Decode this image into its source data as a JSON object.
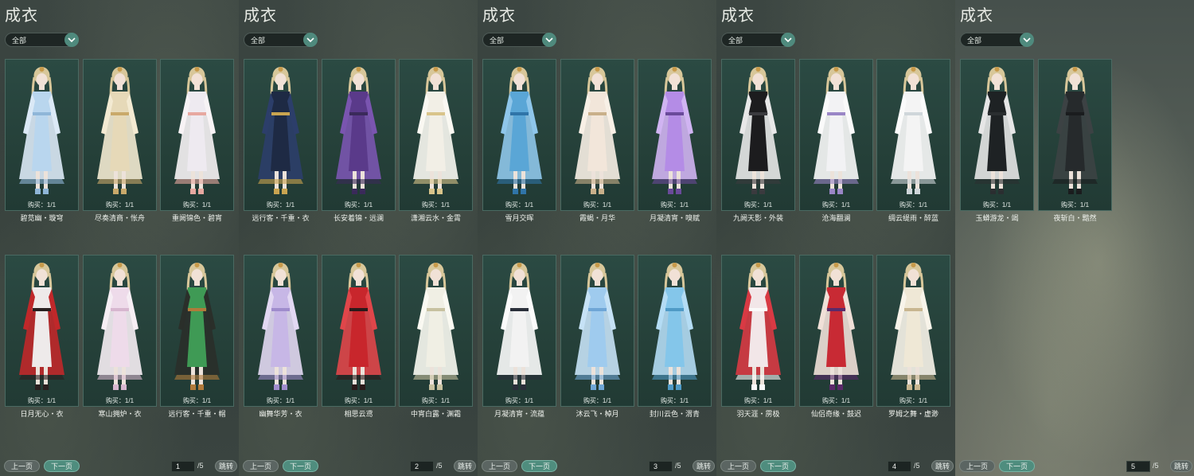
{
  "colors": {
    "accent": "#4f8d7e",
    "card_bg": "#254039",
    "text": "#eef1ec"
  },
  "icons": {
    "filter_dropdown": "chevron-down-icon",
    "outfit_figure": "character-figure-icon"
  },
  "panels": [
    {
      "title": "成衣",
      "filter": "全部",
      "prev_label": "上一页",
      "next_label": "下一页",
      "page": "1",
      "total": "/5",
      "jump_label": "跳转",
      "items": [
        {
          "name": "碧苋幽・璇穹",
          "buy": "购买：1/1",
          "palette": [
            "#b9d6ee",
            "#dbe9f6",
            "#8fb6d8"
          ]
        },
        {
          "name": "尽奏清商・怅舟",
          "buy": "购买：1/1",
          "palette": [
            "#e6d9b8",
            "#f3ead2",
            "#c9a96a"
          ]
        },
        {
          "name": "重阙锦色・碧宵",
          "buy": "购买：1/1",
          "palette": [
            "#eeeaf0",
            "#f7f3f5",
            "#e7a8a0"
          ]
        },
        {
          "name": "日月无心・衣",
          "buy": "购买：1/1",
          "palette": [
            "#eeeaea",
            "#c0282a",
            "#2a2020"
          ]
        },
        {
          "name": "寒山拥炉・衣",
          "buy": "购买：1/1",
          "palette": [
            "#eedbea",
            "#f6eef4",
            "#d7b7cf"
          ]
        },
        {
          "name": "远行客・千重・帽",
          "buy": "购买：1/1",
          "palette": [
            "#3f9a55",
            "#2a2f2a",
            "#b07a3a"
          ]
        }
      ]
    },
    {
      "title": "成衣",
      "filter": "全部",
      "prev_label": "上一页",
      "next_label": "下一页",
      "page": "2",
      "total": "/5",
      "jump_label": "跳转",
      "items": [
        {
          "name": "远行客・千重・衣",
          "buy": "购买：1/1",
          "palette": [
            "#1e2a44",
            "#2c3e6a",
            "#c9a450"
          ]
        },
        {
          "name": "长安着锦・远澜",
          "buy": "购买：1/1",
          "palette": [
            "#5a3a8a",
            "#7a55b0",
            "#3a2a5a"
          ]
        },
        {
          "name": "潇湘云水・金霄",
          "buy": "购买：1/1",
          "palette": [
            "#f2efe6",
            "#faf8f2",
            "#d9c48a"
          ]
        },
        {
          "name": "幽舞华芳・衣",
          "buy": "购买：1/1",
          "palette": [
            "#c7b7e6",
            "#e2d8f2",
            "#9f8ccc"
          ]
        },
        {
          "name": "相思云鸢",
          "buy": "购买：1/1",
          "palette": [
            "#c8262c",
            "#e0464a",
            "#2a1a1a"
          ]
        },
        {
          "name": "中宵白露・渊霜",
          "buy": "购买：1/1",
          "palette": [
            "#f0efe4",
            "#faf9f2",
            "#c7c1a0"
          ]
        }
      ]
    },
    {
      "title": "成衣",
      "filter": "全部",
      "prev_label": "上一页",
      "next_label": "下一页",
      "page": "3",
      "total": "/5",
      "jump_label": "跳转",
      "items": [
        {
          "name": "雪月交晖",
          "buy": "购买：1/1",
          "palette": [
            "#5aa6d6",
            "#8fc6ea",
            "#2f74a8"
          ]
        },
        {
          "name": "霞蝎・月华",
          "buy": "购买：1/1",
          "palette": [
            "#f2e6da",
            "#f8f0e6",
            "#c9b08a"
          ]
        },
        {
          "name": "月凝清宵・嗅赋",
          "buy": "购买：1/1",
          "palette": [
            "#b48ce6",
            "#d0b4f2",
            "#6a4a9a"
          ]
        },
        {
          "name": "月凝清宵・流蕴",
          "buy": "购买：1/1",
          "palette": [
            "#f2f2f2",
            "#fbfbfb",
            "#2a2f3a"
          ]
        },
        {
          "name": "沐云飞・棹月",
          "buy": "购买：1/1",
          "palette": [
            "#9fcbee",
            "#c6e2f6",
            "#6fa6d6"
          ]
        },
        {
          "name": "封川云色・渭青",
          "buy": "购买：1/1",
          "palette": [
            "#84c6ea",
            "#b4dcf4",
            "#4f9ac6"
          ]
        }
      ]
    },
    {
      "title": "成衣",
      "filter": "全部",
      "prev_label": "上一页",
      "next_label": "下一页",
      "page": "4",
      "total": "/5",
      "jump_label": "跳转",
      "items": [
        {
          "name": "九阙天影・外装",
          "buy": "购买：1/1",
          "palette": [
            "#1c1c1e",
            "#e8e8e8",
            "#3a3a3e"
          ]
        },
        {
          "name": "沧海翻澜",
          "buy": "购买：1/1",
          "palette": [
            "#f2f2f4",
            "#fafafa",
            "#9a86c6"
          ]
        },
        {
          "name": "绸云缇雨・醉蓝",
          "buy": "购买：1/1",
          "palette": [
            "#f4f4f4",
            "#fbfbfb",
            "#cfd6da"
          ]
        },
        {
          "name": "羽天涯・雳极",
          "buy": "购买：1/1",
          "palette": [
            "#f2e6e8",
            "#d83a44",
            "#fafafa"
          ]
        },
        {
          "name": "仙侣奇缘・鼓迟",
          "buy": "购买：1/1",
          "palette": [
            "#c82a34",
            "#f0e0d8",
            "#5a2a6a"
          ]
        },
        {
          "name": "罗姆之舞・虚渺",
          "buy": "购买：1/1",
          "palette": [
            "#efe8d6",
            "#f8f4ea",
            "#c8b690"
          ]
        }
      ]
    },
    {
      "title": "成衣",
      "filter": "全部",
      "prev_label": "上一页",
      "next_label": "下一页",
      "page": "5",
      "total": "/5",
      "jump_label": "跳转",
      "items": [
        {
          "name": "玉蟒游龙・竭",
          "buy": "购买：1/1",
          "palette": [
            "#1e2224",
            "#e6e6e6",
            "#2a2e30"
          ]
        },
        {
          "name": "夜斩白・黯然",
          "buy": "购买：1/1",
          "palette": [
            "#262a2c",
            "#3c4244",
            "#1a1c1e"
          ]
        }
      ]
    }
  ]
}
